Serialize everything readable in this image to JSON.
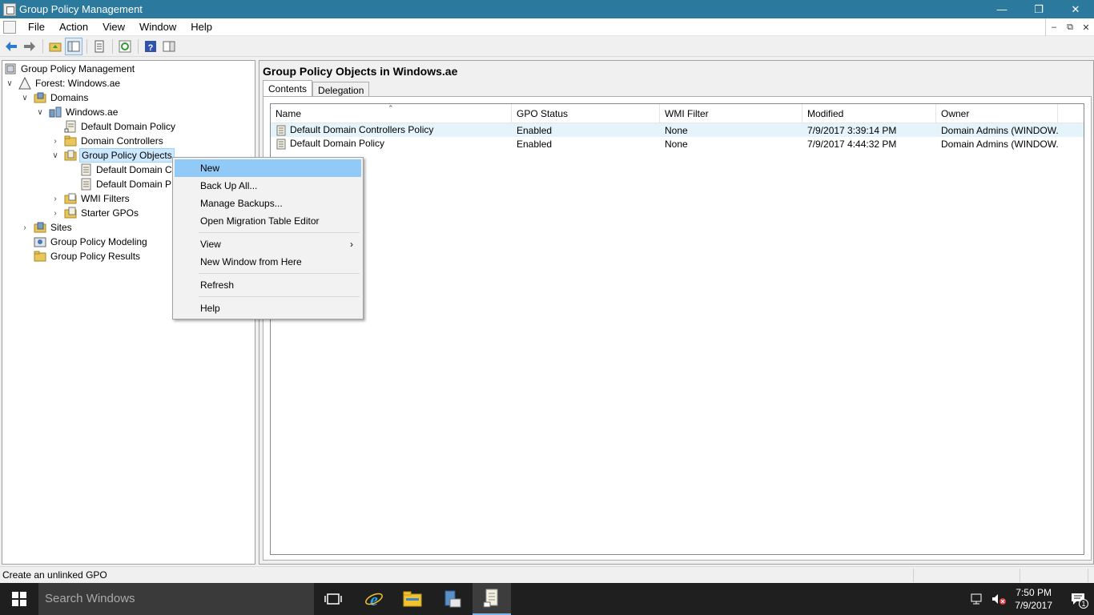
{
  "window": {
    "title": "Group Policy Management"
  },
  "menu": {
    "items": [
      "File",
      "Action",
      "View",
      "Window",
      "Help"
    ]
  },
  "tree": {
    "root": "Group Policy Management",
    "forest": "Forest: Windows.ae",
    "domains": "Domains",
    "domain": "Windows.ae",
    "ddp": "Default Domain Policy",
    "dc": "Domain Controllers",
    "gpo": "Group Policy Objects",
    "gpo_child1": "Default Domain C",
    "gpo_child2": "Default Domain P",
    "wmi": "WMI Filters",
    "starter": "Starter GPOs",
    "sites": "Sites",
    "modeling": "Group Policy Modeling",
    "results": "Group Policy Results"
  },
  "right": {
    "title": "Group Policy Objects in Windows.ae",
    "tabs": [
      "Contents",
      "Delegation"
    ],
    "columns": [
      "Name",
      "GPO Status",
      "WMI Filter",
      "Modified",
      "Owner"
    ],
    "rows": [
      [
        "Default Domain Controllers Policy",
        "Enabled",
        "None",
        "7/9/2017 3:39:14 PM",
        "Domain Admins (WINDOW..."
      ],
      [
        "Default Domain Policy",
        "Enabled",
        "None",
        "7/9/2017 4:44:32 PM",
        "Domain Admins (WINDOW..."
      ]
    ]
  },
  "context_menu": {
    "new": "New",
    "backup_all": "Back Up All...",
    "manage_backups": "Manage Backups...",
    "migration": "Open Migration Table Editor",
    "view": "View",
    "new_window": "New Window from Here",
    "refresh": "Refresh",
    "help": "Help",
    "submenu_arrow": "›"
  },
  "status": {
    "text": "Create an unlinked GPO"
  },
  "taskbar": {
    "search_placeholder": "Search Windows",
    "time": "7:50 PM",
    "date": "7/9/2017",
    "notification_count": "1"
  },
  "colors": {
    "titlebar": "#2b7a9e",
    "selection": "#cce8ff",
    "menu_hot": "#91c9f7",
    "taskbar": "#1f1f1f"
  }
}
